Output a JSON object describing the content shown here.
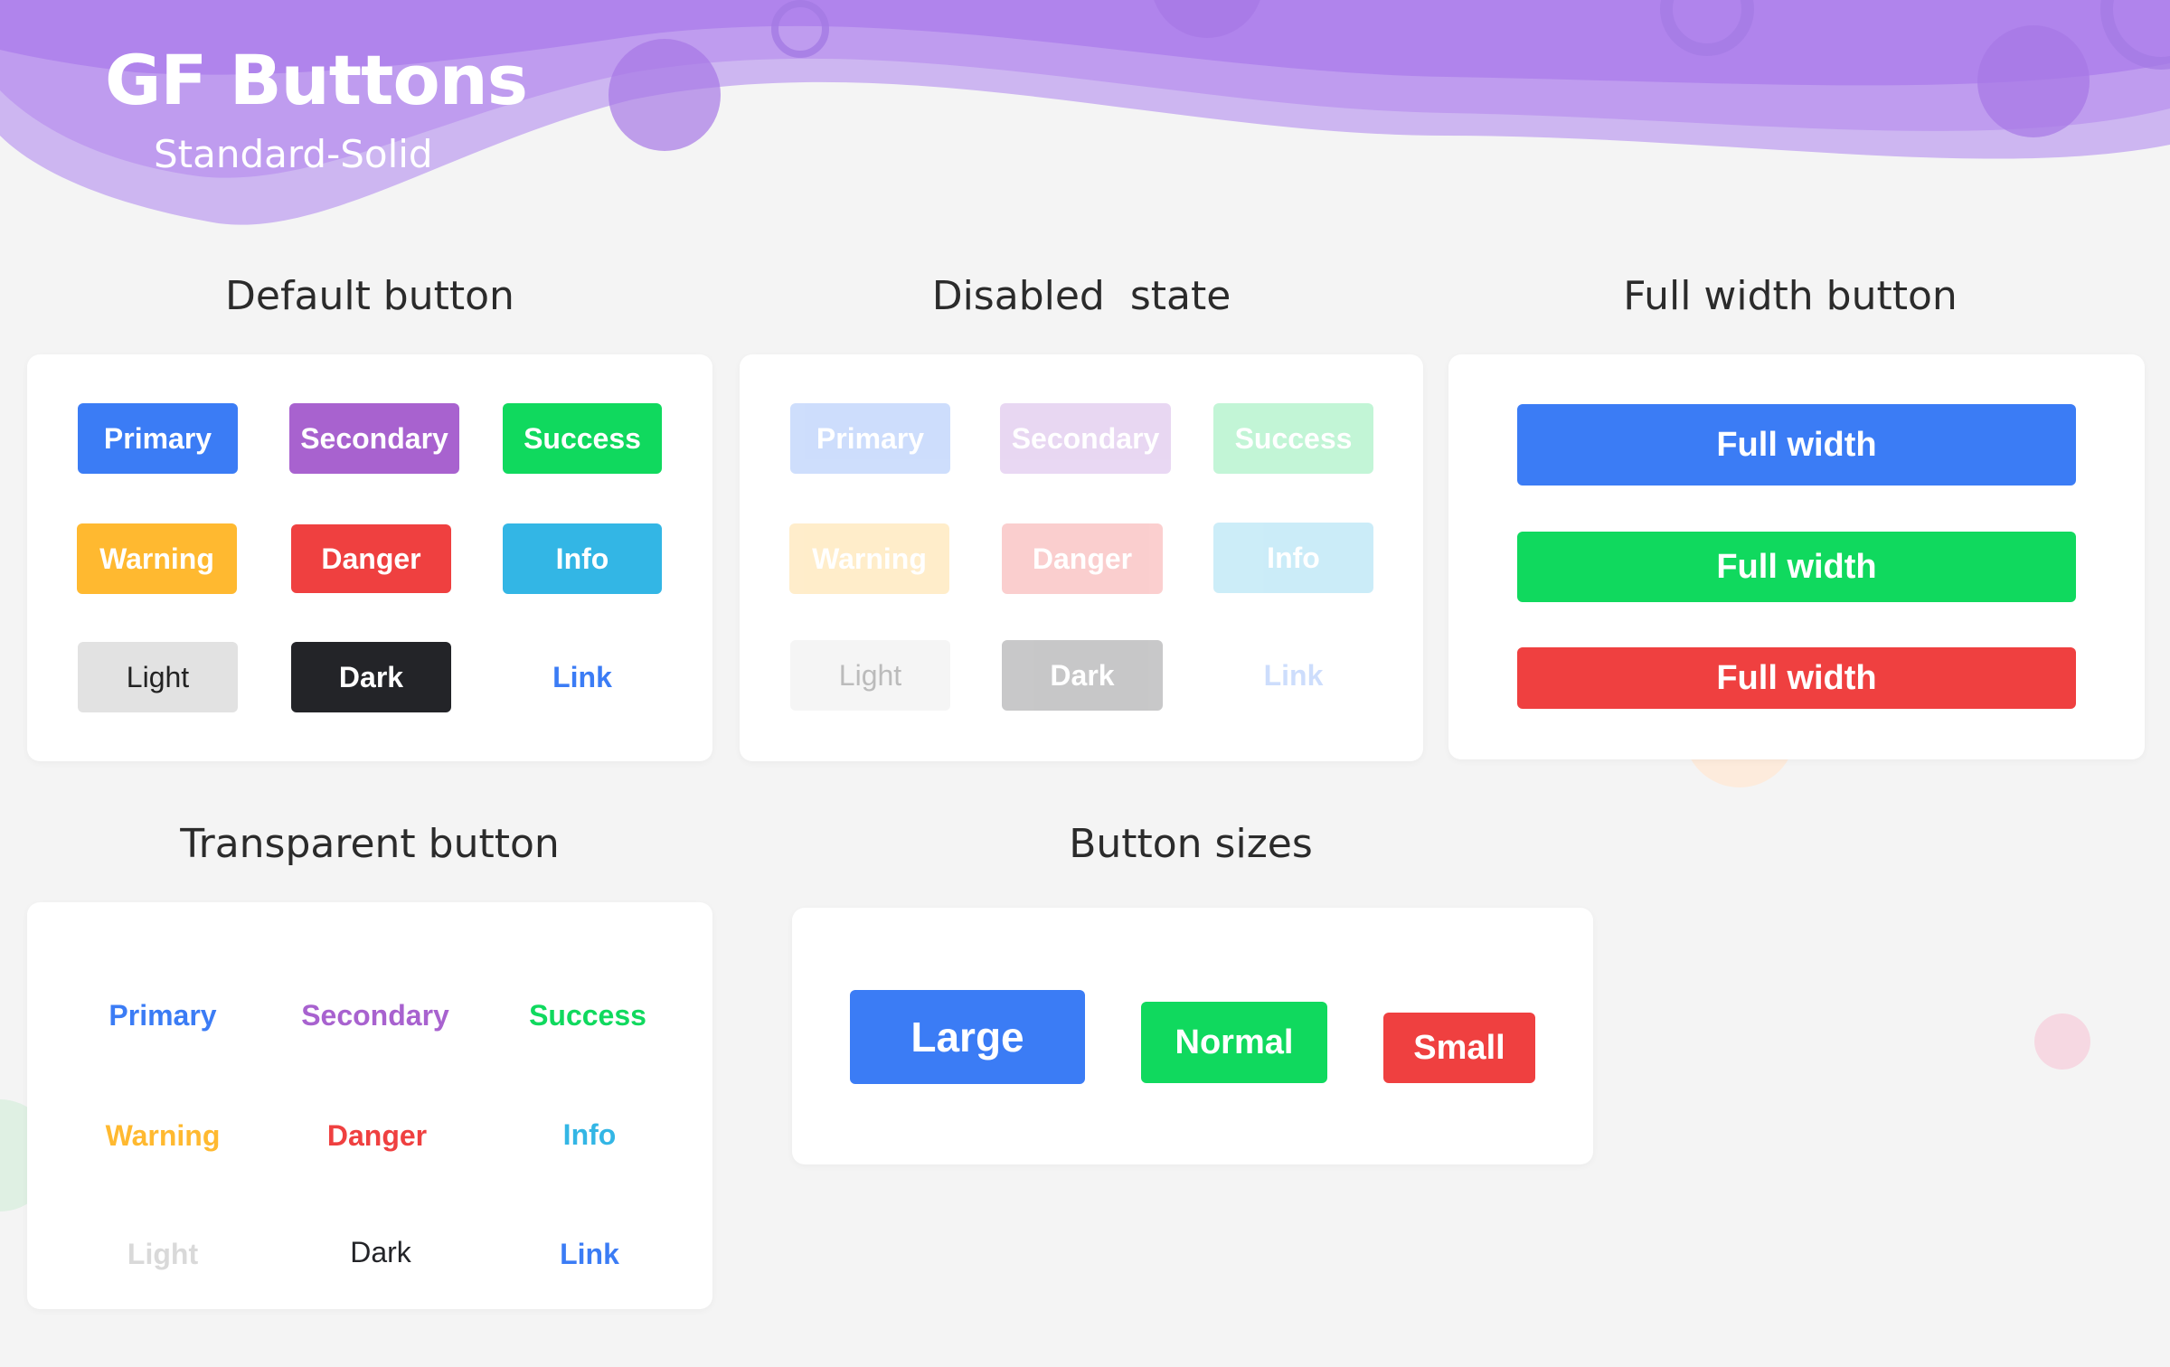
{
  "header": {
    "title": "GF Buttons",
    "subtitle": "Standard-Solid"
  },
  "colors": {
    "primary": "#3b7cf5",
    "secondary": "#a862cf",
    "success": "#10d95e",
    "warning": "#ffb930",
    "danger": "#ef4040",
    "info": "#33b6e5",
    "light": "#e2e2e2",
    "dark": "#232428",
    "link": "#3b7cf5",
    "header_purple": "#b084ec"
  },
  "sections": {
    "default": {
      "title": "Default button",
      "buttons": [
        "Primary",
        "Secondary",
        "Success",
        "Warning",
        "Danger",
        "Info",
        "Light",
        "Dark",
        "Link"
      ]
    },
    "disabled": {
      "title": "Disabled  state",
      "buttons": [
        "Primary",
        "Secondary",
        "Success",
        "Warning",
        "Danger",
        "Info",
        "Light",
        "Dark",
        "Link"
      ]
    },
    "full_width": {
      "title": "Full width button",
      "buttons": [
        "Full width",
        "Full width",
        "Full width"
      ]
    },
    "transparent": {
      "title": "Transparent button",
      "buttons": [
        "Primary",
        "Secondary",
        "Success",
        "Warning",
        "Danger",
        "Info",
        "Light",
        "Dark",
        "Link"
      ]
    },
    "sizes": {
      "title": "Button sizes",
      "buttons": [
        "Large",
        "Normal",
        "Small"
      ]
    }
  }
}
